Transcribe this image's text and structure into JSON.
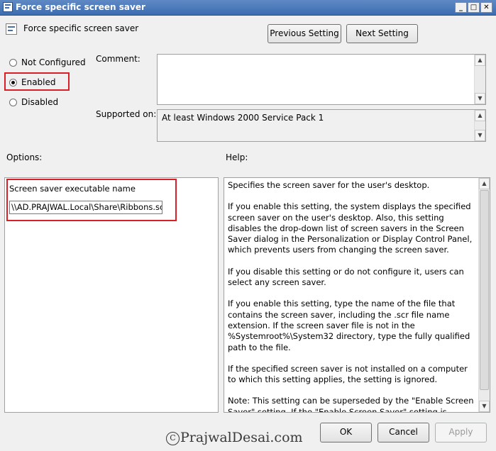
{
  "window": {
    "title": "Force specific screen saver",
    "controls": {
      "minimize": "_",
      "maximize": "□",
      "close": "✕"
    }
  },
  "header": {
    "policy_name": "Force specific screen saver",
    "prev_button": "Previous Setting",
    "next_button": "Next Setting"
  },
  "state": {
    "options": [
      {
        "label": "Not Configured",
        "selected": false
      },
      {
        "label": "Enabled",
        "selected": true
      },
      {
        "label": "Disabled",
        "selected": false
      }
    ]
  },
  "comment": {
    "label": "Comment:",
    "value": ""
  },
  "supported": {
    "label": "Supported on:",
    "value": "At least Windows 2000 Service Pack 1"
  },
  "options_panel": {
    "label": "Options:",
    "field_label": "Screen saver executable name",
    "field_value": "\\\\AD.PRAJWAL.Local\\Share\\Ribbons.scr"
  },
  "help": {
    "label": "Help:",
    "paragraphs": [
      "Specifies the screen saver for the user's desktop.",
      "If you enable this setting, the system displays the specified screen saver on the user's desktop. Also, this setting disables the drop-down list of screen savers in the Screen Saver dialog in the Personalization or Display Control Panel, which prevents users from changing the screen saver.",
      "If you disable this setting or do not configure it, users can select any screen saver.",
      "If you enable this setting, type the name of the file that contains the screen saver, including the .scr file name extension. If the screen saver file is not in the %Systemroot%\\System32 directory, type the fully qualified path to the file.",
      "If the specified screen saver is not installed on a computer to which this setting applies, the setting is ignored.",
      "Note: This setting can be superseded by the \"Enable Screen Saver\" setting.  If the \"Enable Screen Saver\" setting is disabled, this"
    ]
  },
  "footer": {
    "ok": "OK",
    "cancel": "Cancel",
    "apply": "Apply"
  },
  "watermark": {
    "copyright": "C",
    "text": "PrajwalDesai.com"
  },
  "colors": {
    "highlight_red": "#d92027",
    "titlebar_blue": "#3c6db1"
  }
}
